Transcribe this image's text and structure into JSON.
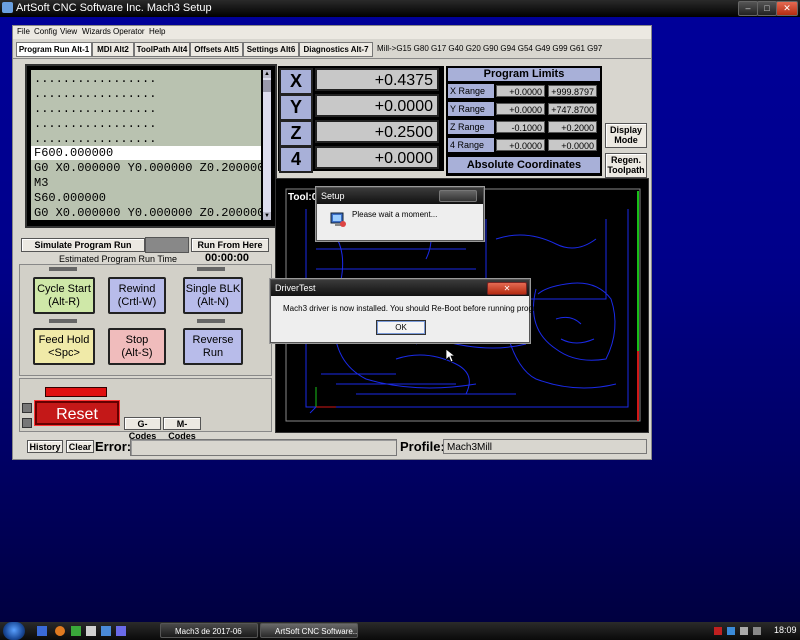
{
  "window": {
    "title": "ArtSoft CNC Software Inc. Mach3 Setup",
    "min": "–",
    "max": "□",
    "close": "✕"
  },
  "menu": [
    "File",
    "Config",
    "View",
    "Wizards",
    "Operator",
    "Help"
  ],
  "tabs": [
    "Program Run Alt-1",
    "MDI Alt2",
    "ToolPath Alt4",
    "Offsets Alt5",
    "Settings Alt6",
    "Diagnostics Alt-7"
  ],
  "gcode_status": "Mill->G15  G80 G17 G40 G20 G90 G94 G54 G49 G99 G61 G97",
  "gcode_lines": [
    ".................",
    ".................",
    ".................",
    ".................",
    ".................",
    "F600.000000",
    "G0 X0.000000 Y0.000000 Z0.200000",
    "M3",
    "S60.000000",
    "G0 X0.000000 Y0.000000 Z0.200000"
  ],
  "run_controls": {
    "simulate": "Simulate Program Run",
    "run_from_here": "Run From Here",
    "est_label": "Estimated Program Run Time",
    "est_time": "00:00:00"
  },
  "buttons": {
    "cycle_start": [
      "Cycle Start",
      "(Alt-R)"
    ],
    "rewind": [
      "Rewind",
      "(Crtl-W)"
    ],
    "single_blk": [
      "Single BLK",
      "(Alt-N)"
    ],
    "feed_hold": [
      "Feed Hold",
      "<Spc>"
    ],
    "stop": [
      "Stop",
      "(Alt-S)"
    ],
    "reverse_run": [
      "Reverse",
      "Run"
    ],
    "reset": "Reset",
    "g_codes": "G-Codes",
    "m_codes": "M-Codes"
  },
  "dro": [
    {
      "axis": "X",
      "value": "+0.4375"
    },
    {
      "axis": "Y",
      "value": "+0.0000"
    },
    {
      "axis": "Z",
      "value": "+0.2500"
    },
    {
      "axis": "4",
      "value": "+0.0000"
    }
  ],
  "program_limits": {
    "title": "Program Limits",
    "rows": [
      {
        "label": "X Range",
        "min": "+0.0000",
        "max": "+999.8797"
      },
      {
        "label": "Y Range",
        "min": "+0.0000",
        "max": "+747.8700"
      },
      {
        "label": "Z Range",
        "min": "-0.1000",
        "max": "+0.2000"
      },
      {
        "label": "4 Range",
        "min": "+0.0000",
        "max": "+0.0000"
      }
    ],
    "abs_coords": "Absolute Coordinates"
  },
  "side_buttons": {
    "display_mode": [
      "Display",
      "Mode"
    ],
    "regen": [
      "Regen.",
      "Toolpath"
    ]
  },
  "toolpath": {
    "tool_label": "Tool:0"
  },
  "bottom": {
    "history": "History",
    "clear": "Clear",
    "error_label": "Error:",
    "error_value": "",
    "profile_label": "Profile:",
    "profile_value": "Mach3Mill"
  },
  "setup_dialog": {
    "title": "Setup",
    "message": "Please wait a moment..."
  },
  "driver_dialog": {
    "title": "DriverTest",
    "message": "Mach3 driver is now installed. You should Re-Boot before running program again.",
    "ok": "OK",
    "close": "✕"
  },
  "taskbar": {
    "items": [
      "Mach3 de 2017-06",
      "ArtSoft CNC Software..."
    ],
    "clock": "18:09"
  },
  "colors": {
    "desktop": "#00008a",
    "dro_label": "#a8b0d8",
    "reset": "#c01818",
    "toolpath_lines": "#1a2ae8"
  }
}
